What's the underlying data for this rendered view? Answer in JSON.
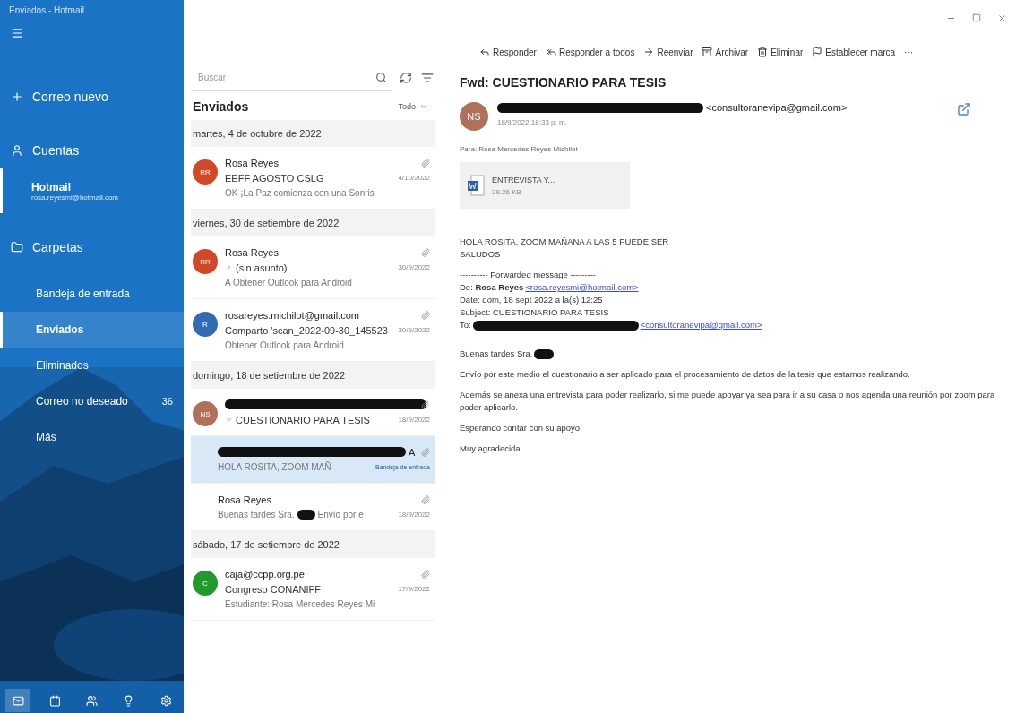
{
  "window": {
    "title": "Enviados - Hotmail"
  },
  "sidebar": {
    "new_mail": "Correo nuevo",
    "accounts_header": "Cuentas",
    "accounts": [
      {
        "name": "Hotmail",
        "email": "rosa.reyesmi@hotmail.com",
        "selected": true
      }
    ],
    "folders_header": "Carpetas",
    "folders": [
      {
        "name": "Bandeja de entrada",
        "selected": false
      },
      {
        "name": "Enviados",
        "selected": true
      },
      {
        "name": "Eliminados",
        "selected": false
      },
      {
        "name": "Correo no deseado",
        "count": "36",
        "selected": false
      },
      {
        "name": "Más",
        "selected": false
      }
    ],
    "bottom_nav": [
      {
        "kind": "mail",
        "selected": true
      },
      {
        "kind": "calendar",
        "selected": false
      },
      {
        "kind": "people",
        "selected": false
      },
      {
        "kind": "tips",
        "selected": false
      },
      {
        "kind": "settings",
        "selected": false
      }
    ]
  },
  "message_list": {
    "search": {
      "placeholder": "Buscar"
    },
    "folder_title": "Enviados",
    "filter": "Todo",
    "groups": [
      {
        "date": "martes, 4 de octubre de 2022",
        "items": [
          {
            "initials": "RR",
            "color": "#d24726",
            "sender": "Rosa Reyes",
            "subject": "EEFF AGOSTO CSLG",
            "date": "4/10/2022",
            "preview": [
              "OK ¡La Paz comienza con una Sonris"
            ],
            "selected": false
          }
        ]
      },
      {
        "date": "viernes, 30 de setiembre de 2022",
        "items": [
          {
            "initials": "RR",
            "color": "#d24726",
            "sender": "Rosa Reyes",
            "subject": "(sin asunto)",
            "replied": true,
            "date": "30/9/2022",
            "preview": [
              "A Obtener Outlook para Android"
            ],
            "selected": false
          },
          {
            "initials": "R",
            "color": "#2f6cb3",
            "sender": "rosareyes.michilot@gmail.com",
            "subject": "Comparto 'scan_2022-09-30_145523",
            "date": "30/9/2022",
            "preview": [
              "Obtener Outlook para Android"
            ],
            "selected": false
          }
        ]
      },
      {
        "date": "domingo, 18 de setiembre de 2022",
        "items": [
          {
            "initials": "NS",
            "color": "#b0705a",
            "redacted": true,
            "subject": "CUESTIONARIO PARA TESIS",
            "expanded": true,
            "date": "18/9/2022",
            "selected": false,
            "children": [
              {
                "redacted": true,
                "sender": "A",
                "preview": [
                  "HOLA ROSITA, ZOOM MAÑ"
                ],
                "tag": "Bandeja de entrada",
                "selected": true
              },
              {
                "sender": "Rosa Reyes",
                "preview": [
                  "Buenas tardes Sra.",
                  "Envío por e"
                ],
                "date": "18/9/2022",
                "selected": false
              }
            ]
          }
        ]
      },
      {
        "date": "sábado, 17 de setiembre de 2022",
        "items": [
          {
            "initials": "C",
            "color": "#1f9a2b",
            "sender": "caja@ccpp.org.pe",
            "subject": "Congreso CONANIFF",
            "date": "17/9/2022",
            "preview": [
              "Estudiante: Rosa Mercedes Reyes Mi"
            ],
            "selected": false
          }
        ]
      }
    ]
  },
  "reading_pane": {
    "toolbar": [
      {
        "kind": "reply",
        "label": "Responder"
      },
      {
        "kind": "reply_all",
        "label": "Responder a todos"
      },
      {
        "kind": "forward",
        "label": "Reenviar"
      },
      {
        "kind": "archive",
        "label": "Archivar"
      },
      {
        "kind": "delete",
        "label": "Eliminar"
      },
      {
        "kind": "flag",
        "label": "Establecer marca"
      },
      {
        "kind": "more",
        "label": "···"
      }
    ],
    "subject": "Fwd: CUESTIONARIO PARA TESIS",
    "sender": {
      "initials": "NS",
      "color": "#b0705a",
      "redacted": true,
      "address": "<consultoranevipa@gmail.com>",
      "date": "18/9/2022 18:33 p. m."
    },
    "to": "Para: Rosa Mercedes Reyes Michilot",
    "attachment": {
      "name": "ENTREVISTA Y...",
      "size": "29.26 KB"
    },
    "body": [
      {
        "kind": "line",
        "text": "HOLA ROSITA, ZOOM MAÑANA A LAS 5 PUEDE SER"
      },
      {
        "kind": "line",
        "text": "SALUDOS"
      },
      {
        "kind": "gap"
      },
      {
        "kind": "line",
        "text": "---------- Forwarded message ---------"
      },
      {
        "kind": "from",
        "text": "De: **Rosa Reyes** ",
        "link": "<rosa.reyesmi@hotmail.com>"
      },
      {
        "kind": "line",
        "text": "Date: dom, 18 sept 2022 a la(s) 12:25"
      },
      {
        "kind": "line",
        "text": "Subject: CUESTIONARIO PARA TESIS"
      },
      {
        "kind": "to",
        "text": "To: ",
        "link": "<consultoranevipa@gmail.com>"
      },
      {
        "kind": "gap"
      },
      {
        "kind": "gap"
      },
      {
        "kind": "greeting",
        "text": "Buenas tardes Sra."
      },
      {
        "kind": "gap"
      },
      {
        "kind": "line",
        "text": "Envío por este medio el cuestionario a ser aplicado para el procesamiento de datos de la tesis que estamos realizando."
      },
      {
        "kind": "gap"
      },
      {
        "kind": "line",
        "text": "Además se anexa una entrevista para poder realizarlo, si me puede apoyar ya sea para ir a su casa o nos agenda una reunión por zoom para poder aplicarlo."
      },
      {
        "kind": "gap"
      },
      {
        "kind": "line",
        "text": "Esperando contar con su apoyo."
      },
      {
        "kind": "gap"
      },
      {
        "kind": "line",
        "text": "Muy agradecida"
      }
    ]
  }
}
